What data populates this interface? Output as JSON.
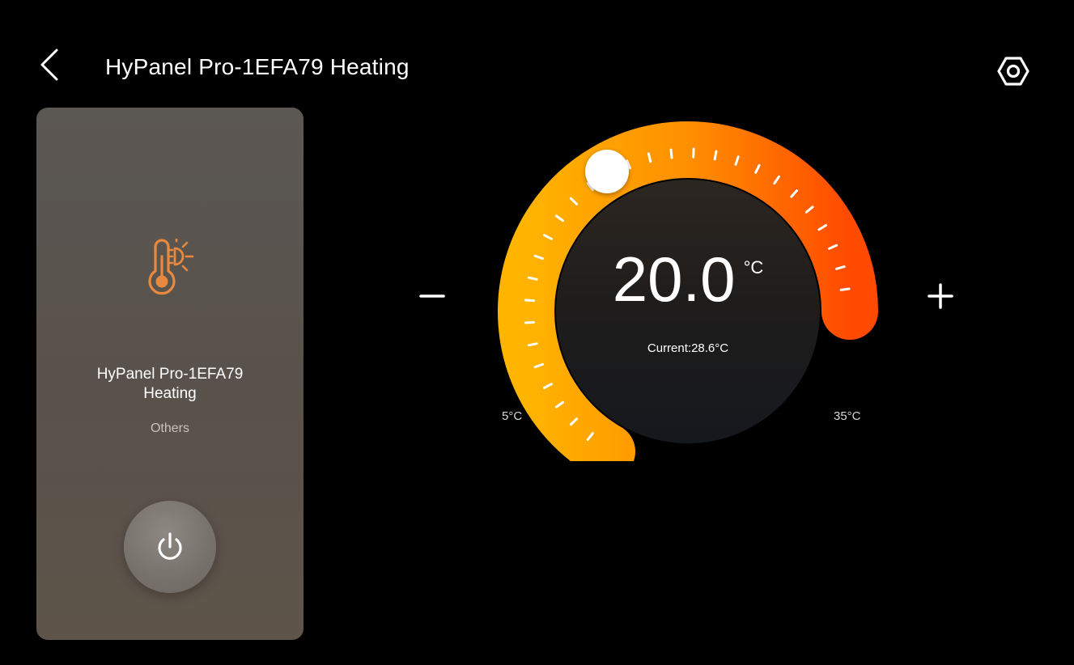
{
  "header": {
    "title": "HyPanel Pro-1EFA79 Heating",
    "back_icon": "chevron-left-icon",
    "settings_icon": "hexagon-settings-icon"
  },
  "device_card": {
    "icon": "thermometer-sun-icon",
    "name_line1": "HyPanel Pro-1EFA79",
    "name_line2": "Heating",
    "category": "Others",
    "power_icon": "power-icon"
  },
  "thermostat": {
    "set_temp": "20.0",
    "unit": "°C",
    "current_label": "Current:28.6°C",
    "min_label": "5°C",
    "max_label": "35°C",
    "min_value": 5,
    "max_value": 35,
    "set_value": 20.0,
    "decrease_icon": "minus-icon",
    "increase_icon": "plus-icon",
    "gradient_start": "#ffb400",
    "gradient_end": "#ff4a00"
  },
  "colors": {
    "background": "#000000",
    "card": "#5a544e",
    "accent_orange": "#e8893f"
  }
}
